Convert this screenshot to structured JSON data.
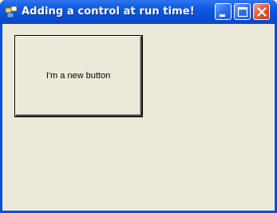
{
  "window": {
    "title": "Adding a control at run time!"
  },
  "icons": {
    "app": "app-icon",
    "minimize": "minimize-icon",
    "maximize": "maximize-icon",
    "close": "close-icon"
  },
  "colors": {
    "titlebar": "#0a4fd6",
    "client_background": "#ece9d8",
    "close_button": "#de5a32"
  },
  "main": {
    "new_button_label": "I'm a new button"
  }
}
